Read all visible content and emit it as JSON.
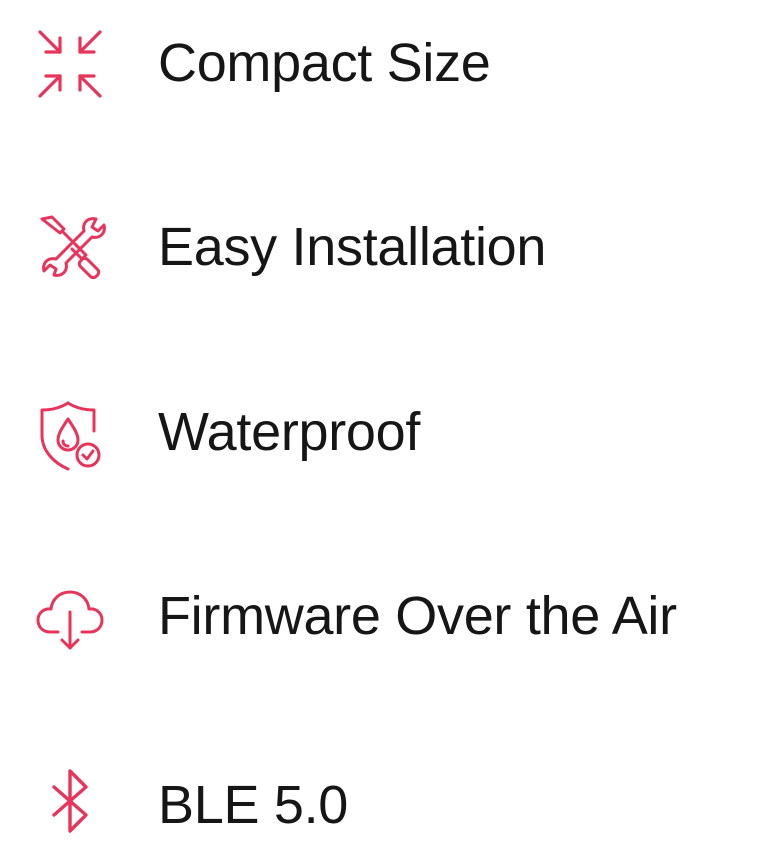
{
  "accent_color": "#e8335a",
  "features": [
    {
      "label": "Compact Size",
      "icon": "compress-arrows-icon"
    },
    {
      "label": "Easy Installation",
      "icon": "tools-icon"
    },
    {
      "label": "Waterproof",
      "icon": "waterproof-shield-icon"
    },
    {
      "label": "Firmware Over the Air",
      "icon": "cloud-download-icon"
    },
    {
      "label": "BLE 5.0",
      "icon": "bluetooth-icon"
    }
  ]
}
